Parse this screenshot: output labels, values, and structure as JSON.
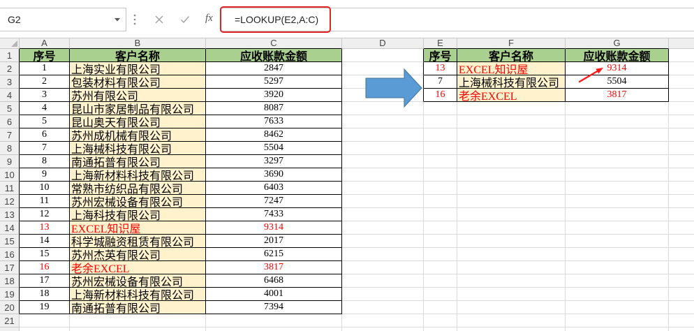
{
  "formula_bar": {
    "name_box": "G2",
    "fx_label": "fx",
    "formula": "=LOOKUP(E2,A:C)",
    "icons": {
      "name_box_dropdown": "chevron-down-icon",
      "more": "vertical-dots-icon",
      "cancel": "close-icon",
      "enter": "check-icon"
    }
  },
  "column_headers": [
    "A",
    "B",
    "C",
    "D",
    "E",
    "F",
    "G"
  ],
  "row_headers": [
    "1",
    "2",
    "3",
    "4",
    "5",
    "6",
    "7",
    "8",
    "9",
    "10",
    "11",
    "12",
    "13",
    "14",
    "15",
    "16",
    "17",
    "18",
    "19",
    "20",
    "21"
  ],
  "source_table": {
    "headers": [
      "序号",
      "客户名称",
      "应收账款金额"
    ],
    "rows": [
      {
        "no": "1",
        "name": "上海实业有限公司",
        "amount": "2847",
        "highlight": false
      },
      {
        "no": "2",
        "name": "包装材料有限公司",
        "amount": "5297",
        "highlight": false
      },
      {
        "no": "3",
        "name": "苏州有限公司",
        "amount": "3920",
        "highlight": false
      },
      {
        "no": "4",
        "name": "昆山市家居制品有限公司",
        "amount": "8087",
        "highlight": false
      },
      {
        "no": "5",
        "name": "昆山奥天有限公司",
        "amount": "7633",
        "highlight": false
      },
      {
        "no": "6",
        "name": "苏州成机械有限公司",
        "amount": "8462",
        "highlight": false
      },
      {
        "no": "7",
        "name": "上海械科技有限公司",
        "amount": "5504",
        "highlight": false
      },
      {
        "no": "8",
        "name": "南通拓普有限公司",
        "amount": "3297",
        "highlight": false
      },
      {
        "no": "9",
        "name": "上海新材料科技有限公司",
        "amount": "3690",
        "highlight": false
      },
      {
        "no": "10",
        "name": "常熟市纺织品有限公司",
        "amount": "6403",
        "highlight": false
      },
      {
        "no": "11",
        "name": "苏州宏械设备有限公司",
        "amount": "7247",
        "highlight": false
      },
      {
        "no": "12",
        "name": "上海科技有限公司",
        "amount": "7433",
        "highlight": false
      },
      {
        "no": "13",
        "name": "EXCEL知识屋",
        "amount": "9314",
        "highlight": true
      },
      {
        "no": "14",
        "name": "科学城融资租赁有限公司",
        "amount": "2017",
        "highlight": false
      },
      {
        "no": "15",
        "name": "苏州杰英有限公司",
        "amount": "6215",
        "highlight": false
      },
      {
        "no": "16",
        "name": "老余EXCEL",
        "amount": "3817",
        "highlight": true
      },
      {
        "no": "17",
        "name": "苏州宏械设备有限公司",
        "amount": "6468",
        "highlight": false
      },
      {
        "no": "18",
        "name": "上海新材料科技有限公司",
        "amount": "4001",
        "highlight": false
      },
      {
        "no": "19",
        "name": "南通拓普有限公司",
        "amount": "7394",
        "highlight": false
      }
    ]
  },
  "lookup_table": {
    "headers": [
      "序号",
      "客户名称",
      "应收账款金额"
    ],
    "rows": [
      {
        "no": "13",
        "name": "EXCEL知识屋",
        "amount": "9314",
        "highlight": true
      },
      {
        "no": "7",
        "name": "上海械科技有限公司",
        "amount": "5504",
        "highlight": false
      },
      {
        "no": "16",
        "name": "老余EXCEL",
        "amount": "3817",
        "highlight": true
      }
    ]
  },
  "annotations": {
    "flow_arrow": "right-arrow-icon",
    "pointer_arrow": "pointer-arrow-icon"
  },
  "colors": {
    "header_fill": "#A9D08E",
    "name_fill": "#FFF2CC",
    "highlight_text": "#FF0000",
    "formula_outline": "#E02424",
    "flow_arrow": "#5B9BD5",
    "flow_arrow_border": "#41719C",
    "pointer_arrow": "#FF1A1A"
  }
}
